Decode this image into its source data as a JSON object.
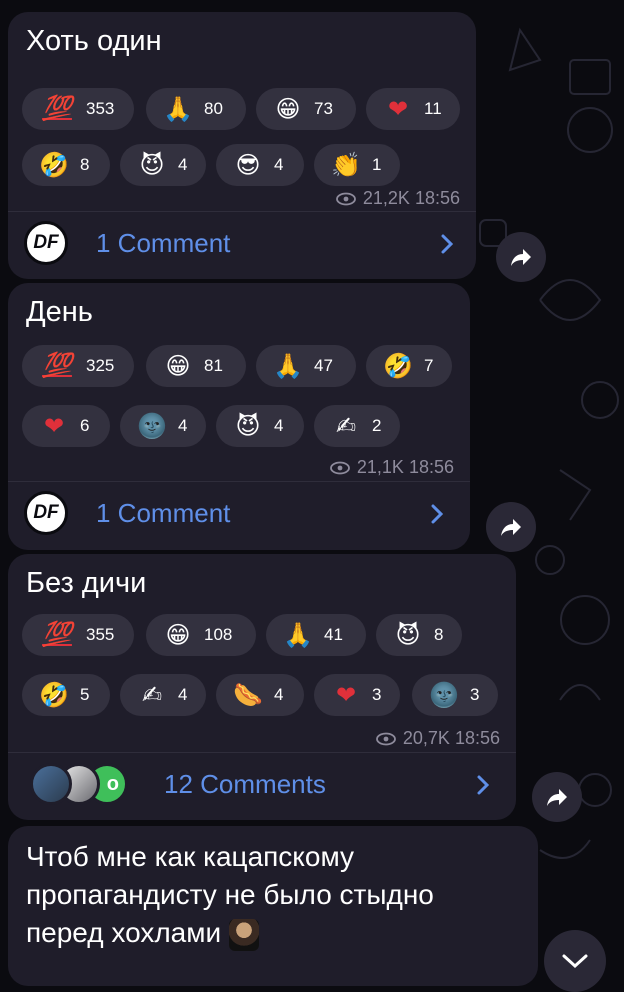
{
  "posts": [
    {
      "title": "Хоть один",
      "reactions": [
        {
          "emoji": "💯",
          "icon": "hundred-icon",
          "count": "353"
        },
        {
          "emoji": "🙏",
          "icon": "folded-hands-icon",
          "count": "80"
        },
        {
          "emoji": "😁",
          "icon": "grin-icon",
          "count": "73"
        },
        {
          "emoji": "❤",
          "icon": "heart-icon",
          "count": "11"
        },
        {
          "emoji": "🤣",
          "icon": "rofl-icon",
          "count": "8"
        },
        {
          "emoji": "😈",
          "icon": "devil-icon",
          "count": "4"
        },
        {
          "emoji": "😎",
          "icon": "sunglasses-icon",
          "count": "4"
        },
        {
          "emoji": "👏",
          "icon": "clap-icon",
          "count": "1"
        }
      ],
      "views": "21,2K",
      "time": "18:56",
      "comments": "1 Comment"
    },
    {
      "title": "День",
      "reactions": [
        {
          "emoji": "💯",
          "icon": "hundred-icon",
          "count": "325"
        },
        {
          "emoji": "😁",
          "icon": "grin-icon",
          "count": "81"
        },
        {
          "emoji": "🙏",
          "icon": "folded-hands-icon",
          "count": "47"
        },
        {
          "emoji": "🤣",
          "icon": "rofl-icon",
          "count": "7"
        },
        {
          "emoji": "❤",
          "icon": "heart-icon",
          "count": "6"
        },
        {
          "emoji": "🌚",
          "icon": "new-moon-face-icon",
          "count": "4"
        },
        {
          "emoji": "😈",
          "icon": "devil-icon",
          "count": "4"
        },
        {
          "emoji": "✍",
          "icon": "writing-hand-icon",
          "count": "2"
        }
      ],
      "views": "21,1K",
      "time": "18:56",
      "comments": "1 Comment"
    },
    {
      "title": "Без дичи",
      "reactions": [
        {
          "emoji": "💯",
          "icon": "hundred-icon",
          "count": "355"
        },
        {
          "emoji": "😁",
          "icon": "grin-icon",
          "count": "108"
        },
        {
          "emoji": "🙏",
          "icon": "folded-hands-icon",
          "count": "41"
        },
        {
          "emoji": "😈",
          "icon": "devil-icon",
          "count": "8"
        },
        {
          "emoji": "🤣",
          "icon": "rofl-icon",
          "count": "5"
        },
        {
          "emoji": "✍",
          "icon": "writing-hand-icon",
          "count": "4"
        },
        {
          "emoji": "🌭",
          "icon": "hotdog-icon",
          "count": "4"
        },
        {
          "emoji": "❤",
          "icon": "heart-icon",
          "count": "3"
        },
        {
          "emoji": "🌚",
          "icon": "new-moon-face-icon",
          "count": "3"
        }
      ],
      "views": "20,7K",
      "time": "18:56",
      "comments": "12 Comments"
    }
  ],
  "last_post": {
    "text_line1": "Чтоб мне как кацапскому",
    "text_line2": "пропагандисту не было стыдно",
    "text_line3": "перед хохлами"
  },
  "channel_logo": "DF",
  "avatar_badge": "o",
  "colors": {
    "background": "#0b0b10",
    "bubble": "#1f1d2a",
    "reaction_pill": "#33313f",
    "link": "#5f8fe8",
    "meta": "#8e8b9c"
  }
}
